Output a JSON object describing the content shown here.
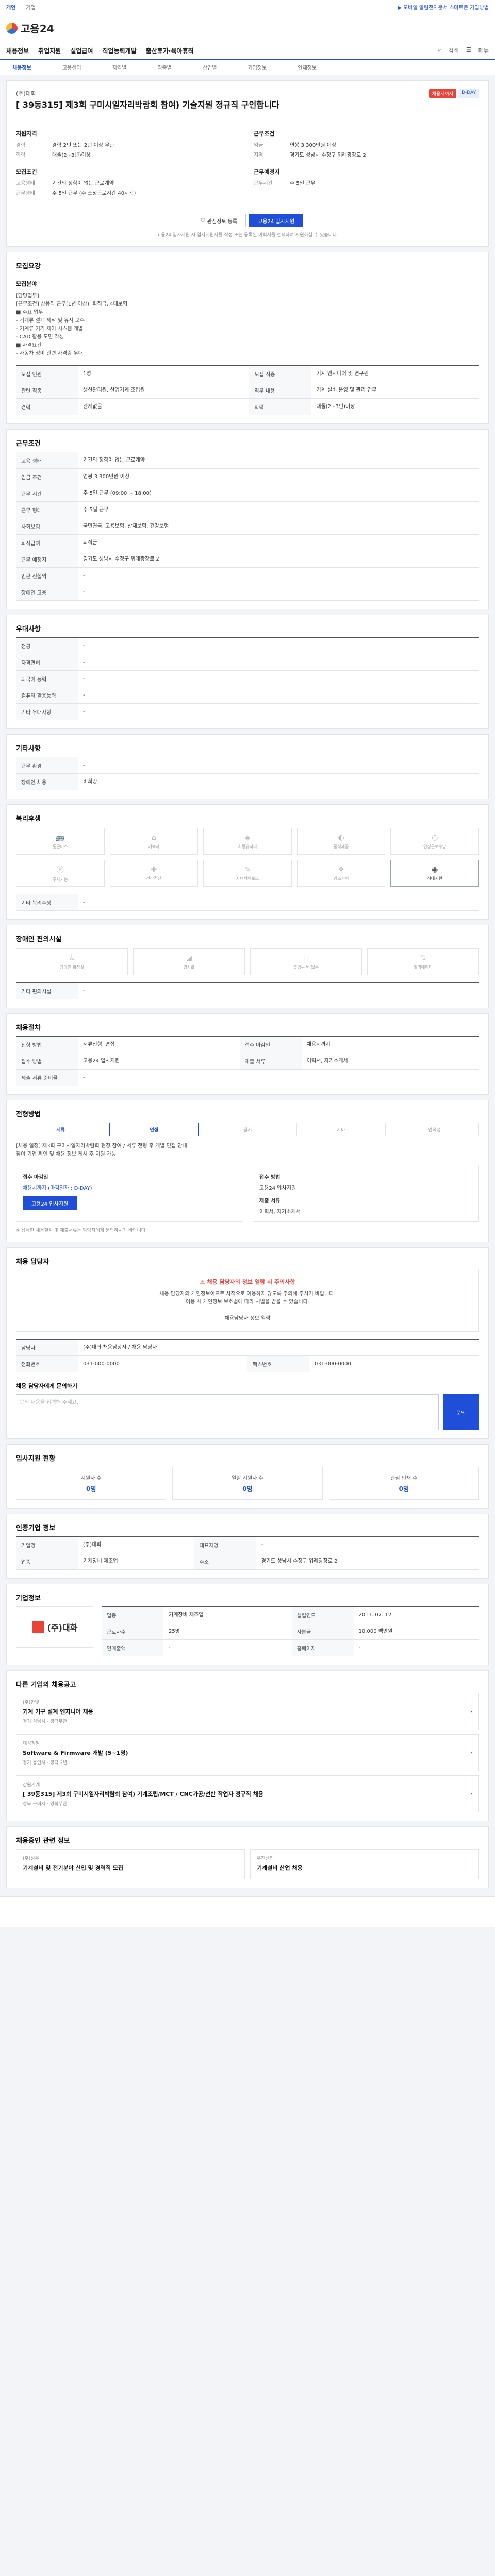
{
  "topbar": {
    "tabs": [
      "개인",
      "기업"
    ],
    "announcement": "▶ 모바일 알림전자문서 스마트폰 가입방법"
  },
  "header": {
    "logo": "고용24"
  },
  "gnb": {
    "items": [
      "채용정보",
      "취업지원",
      "실업급여",
      "직업능력개발",
      "출산휴가·육아휴직"
    ],
    "right": [
      "검색",
      "메뉴"
    ]
  },
  "subnav": {
    "items": [
      "채용정보",
      "고용센터",
      "지역별",
      "직종별",
      "산업별",
      "기업정보",
      "인재정보"
    ]
  },
  "job": {
    "company": "(주)대화",
    "title": "[ 39동315] 제3회 구미시일자리박람회 참여) 기술지원 정규직 구인합니다",
    "status_badge": "채용시까지",
    "d_day": "D-DAY",
    "summary_left_title": "지원자격",
    "summary_left": [
      {
        "k": "경력",
        "v": "경력 2년 또는 2년 이상 무관"
      },
      {
        "k": "학력",
        "v": "대졸(2~3년)이상"
      }
    ],
    "summary_left2_title": "모집조건",
    "summary_left2": [
      {
        "k": "고용형태",
        "v": "기간의 정함이 없는 근로계약"
      },
      {
        "k": "근무형태",
        "v": "주 5일 근무 (주 소정근로시간 40시간)"
      }
    ],
    "summary_right_title": "근무조건",
    "summary_right": [
      {
        "k": "임금",
        "v": "연봉 3,300만원 이상"
      },
      {
        "k": "지역",
        "v": "경기도 성남시 수정구 위례광장로 2"
      }
    ],
    "summary_right2_title": "근무예정지",
    "summary_right2": [
      {
        "k": "근무시간",
        "v": "주 5일 근무"
      }
    ],
    "btn_interest": "관심정보 등록",
    "btn_apply": "고용24 입사지원",
    "apply_notice": "고용24 입사지원 시 입사지원서를 작성 또는 등록된 이력서를 선택하여 지원하실 수 있습니다."
  },
  "sections": {
    "job_desc_title": "모집요강",
    "job_desc_sub": "모집분야",
    "job_desc_text": "[담당업무]\n[근무조건] 상용직 근무(1년 이상), 퇴직금, 4대보험\n■ 주요 업무\n - 기계류 설계 제작 및 유지 보수\n - 기계류 기기 제어 시스템 개발\n - CAD 활용 도면 작성\n ■ 자격요건\n - 자동차 정비 관련 자격증 우대",
    "job_table": [
      {
        "k": "모집 인원",
        "v": "1명"
      },
      {
        "k": "모집 직종",
        "v": "기계 엔지니어 및 연구원"
      },
      {
        "k": "관련 직종",
        "v": "생산관리원, 산업기계 조립원"
      },
      {
        "k": "직무 내용",
        "v": "기계 설비 운영 및 관리 업무"
      },
      {
        "k": "경력",
        "v": "관계없음"
      },
      {
        "k": "학력",
        "v": "대졸(2~3년)이상"
      }
    ],
    "work_title": "근무조건",
    "work_table": [
      {
        "k": "고용 형태",
        "v": "기간의 정함이 없는 근로계약"
      },
      {
        "k": "임금 조건",
        "v": "연봉 3,300만원 이상"
      },
      {
        "k": "근무 시간",
        "v": "주 5일 근무 (09:00 ~ 18:00)"
      },
      {
        "k": "근무 형태",
        "v": "주 5일 근무"
      },
      {
        "k": "사회보험",
        "v": "국민연금, 고용보험, 산재보험, 건강보험"
      },
      {
        "k": "퇴직급여",
        "v": "퇴직금"
      },
      {
        "k": "근무 예정지",
        "v": "경기도 성남시 수정구 위례광장로 2"
      },
      {
        "k": "인근 전철역",
        "v": "-"
      },
      {
        "k": "장애인 고용",
        "v": "-"
      }
    ],
    "pref_title": "우대사항",
    "pref_table": [
      {
        "k": "전공",
        "v": "-"
      },
      {
        "k": "자격면허",
        "v": "-"
      },
      {
        "k": "외국어 능력",
        "v": "-"
      },
      {
        "k": "컴퓨터 활용능력",
        "v": "-"
      },
      {
        "k": "기타 우대사항",
        "v": "-"
      }
    ],
    "other_title": "기타사항",
    "other_table": [
      {
        "k": "근무 환경",
        "v": "-"
      },
      {
        "k": "장애인 채용",
        "v": "비희망"
      }
    ],
    "welfare_title": "복리후생",
    "welfare": [
      {
        "label": "통근버스",
        "on": false
      },
      {
        "label": "기숙사",
        "on": false
      },
      {
        "label": "차량유지비",
        "on": false
      },
      {
        "label": "중식제공",
        "on": false
      },
      {
        "label": "연장근로수당",
        "on": false
      },
      {
        "label": "주차가능",
        "on": false
      },
      {
        "label": "건강검진",
        "on": false
      },
      {
        "label": "자녀학비보조",
        "on": false
      },
      {
        "label": "경조사비",
        "on": false
      },
      {
        "label": "식대지원",
        "on": true
      }
    ],
    "welfare_extra_label": "기타 복리후생",
    "welfare_extra": "-",
    "disabled_title": "장애인 편의시설",
    "disabled": [
      "장애인 화장실",
      "경사로",
      "출입구 턱 없음",
      "엘리베이터"
    ],
    "disabled_extra_label": "기타 편의시설",
    "disabled_extra": "-",
    "recruit_title": "채용절차",
    "recruit_table": [
      {
        "k": "전형 방법",
        "v": "서류전형, 면접"
      },
      {
        "k": "접수 마감일",
        "v": "채용시까지"
      },
      {
        "k": "접수 방법",
        "v": "고용24 입사지원"
      },
      {
        "k": "제출 서류",
        "v": "이력서, 자기소개서"
      },
      {
        "k": "제출 서류 준비물",
        "v": "-"
      }
    ],
    "method_title": "전형방법",
    "methods": [
      {
        "label": "서류",
        "on": true
      },
      {
        "label": "면접",
        "on": true
      },
      {
        "label": "필기",
        "on": false
      },
      {
        "label": "기타",
        "on": false
      },
      {
        "label": "인적성",
        "on": false
      }
    ],
    "method_text": "[채용 일정] 제3회 구미시일자리박람회 현장 참여 / 서류 전형 후 개별 면접 안내\n참여 기업 확인 및 채용 정보 게시 후 지원 가능",
    "contact_title": "접수 마감일",
    "contact_deadline": "채용시까지 (마감일자 : D-DAY)",
    "contact_apply_btn": "고용24 입사지원",
    "contact_method_title": "접수 방법",
    "contact_method": "고용24 입사지원",
    "contact_docs_title": "제출 서류",
    "contact_docs": "이력서, 자기소개서",
    "contact_note": "※ 상세한 채용절차 및 제출서류는 담당자에게 문의하시기 바랍니다.",
    "manager_title": "채용 담당자",
    "warn_title": "채용 담당자의 정보 열람 시 주의사항",
    "warn_text": "채용 담당자의 개인정보이므로 사적으로 이용하지 않도록 주의해 주시기 바랍니다.\n이용 시 개인정보 보호법에 따라 처벌을 받을 수 있습니다.",
    "warn_btn": "채용담당자 정보 열람",
    "manager_name_label": "담당자",
    "manager_name": "(주)대화 채용담당자 / 채용 담당자",
    "manager_tel_label": "전화번호",
    "manager_tel": "031-000-0000",
    "manager_fax_label": "팩스번호",
    "manager_fax": "031-000-0000",
    "inquiry_title": "채용 담당자에게 문의하기",
    "inquiry_placeholder": "문의 내용을 입력해 주세요.",
    "inquiry_btn": "문의",
    "stats_title": "입사지원 현황",
    "stats": [
      {
        "label": "지원자 수",
        "v": "0명"
      },
      {
        "label": "열람 지원자 수",
        "v": "0명"
      },
      {
        "label": "관심 인재 수",
        "v": "0명"
      }
    ],
    "info_title": "인증기업 정보",
    "info_table": [
      {
        "k": "기업명",
        "v": "(주)대화"
      },
      {
        "k": "대표자명",
        "v": "-"
      },
      {
        "k": "업종",
        "v": "기계장비 제조업"
      },
      {
        "k": "주소",
        "v": "경기도 성남시 수정구 위례광장로 2"
      }
    ],
    "company_title": "기업정보",
    "company_name": "(주)대화",
    "company_table": [
      {
        "k": "업종",
        "v": "기계장비 제조업"
      },
      {
        "k": "설립연도",
        "v": "2011. 07. 12"
      },
      {
        "k": "근로자수",
        "v": "25명"
      },
      {
        "k": "자본금",
        "v": "10,000 백만원"
      },
      {
        "k": "연매출액",
        "v": "-"
      },
      {
        "k": "홈페이지",
        "v": "-"
      }
    ],
    "similar_title": "다른 기업의 채용공고",
    "similar": [
      {
        "co": "(주)한빛",
        "t": "기계 기구 설계 엔지니어 채용",
        "meta": "경기 성남시 · 경력무관"
      },
      {
        "co": "대성정밀",
        "t": "Software & Firmware 개발 (5~1명)",
        "meta": "경기 용인시 · 경력 2년"
      },
      {
        "co": "삼원기계",
        "t": "[ 39동315] 제3회 구미시일자리박람회 참여) 기계조립/MCT / CNC가공/선반 작업자 정규직 채용",
        "meta": "경북 구미시 · 경력무관"
      }
    ],
    "related_title": "채용중인 관련 정보",
    "related": [
      {
        "co": "(주)성우",
        "t": "기계설비 및 전기분야 신입 및 경력직 모집"
      },
      {
        "co": "우진산업",
        "t": "기계설비 산업 채용"
      }
    ]
  }
}
